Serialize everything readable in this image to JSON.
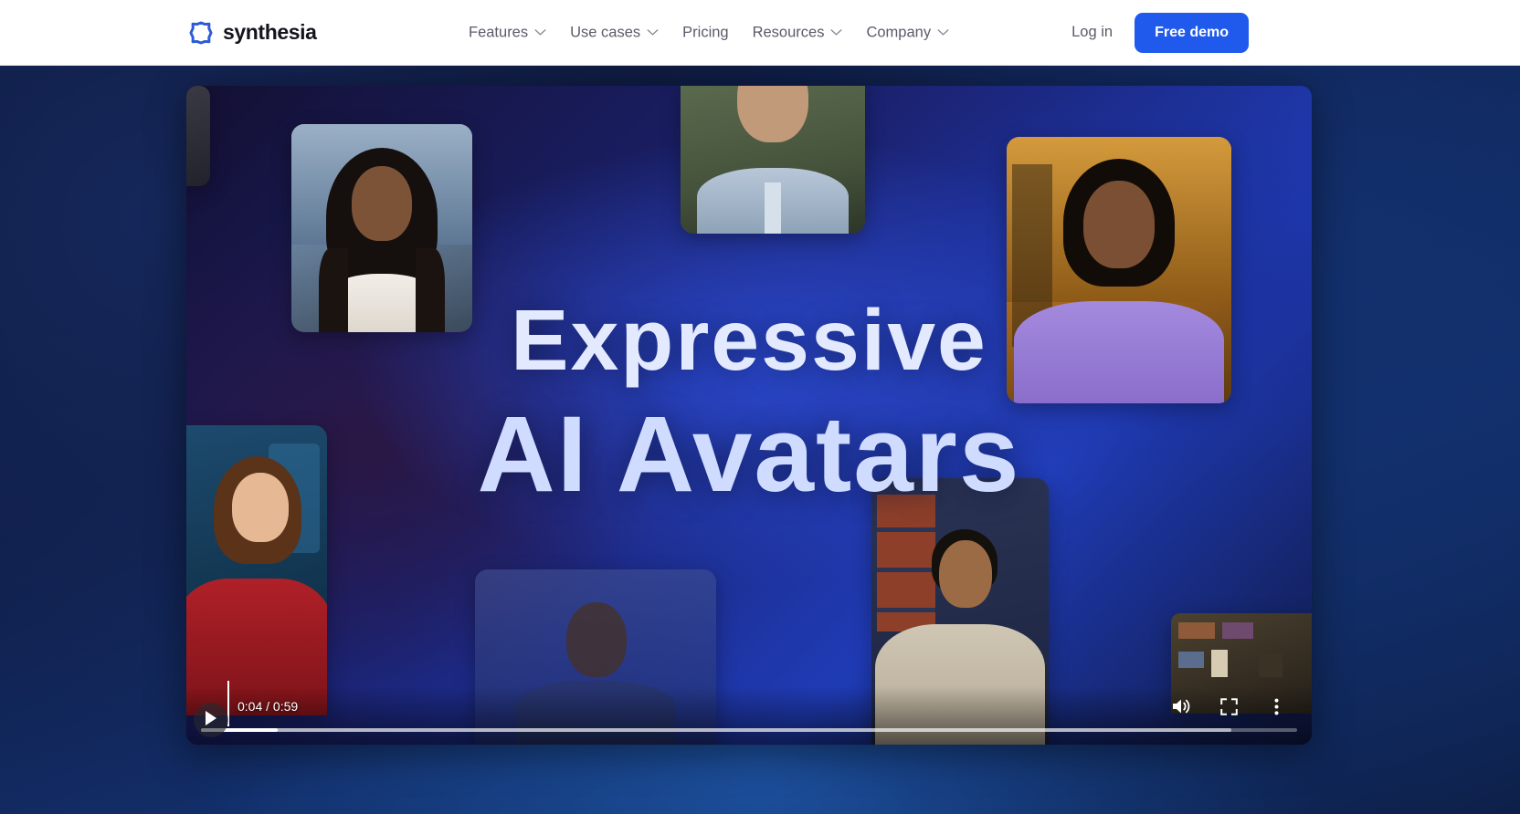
{
  "brand": {
    "name": "synthesia",
    "logo_icon": "synthesia-octagon-logo",
    "accent": "#1f5aec"
  },
  "nav": {
    "items": [
      {
        "label": "Features",
        "has_dropdown": true
      },
      {
        "label": "Use cases",
        "has_dropdown": true
      },
      {
        "label": "Pricing",
        "has_dropdown": false
      },
      {
        "label": "Resources",
        "has_dropdown": true
      },
      {
        "label": "Company",
        "has_dropdown": true
      }
    ],
    "login_label": "Log in",
    "demo_label": "Free demo"
  },
  "video": {
    "title_line1": "Expressive",
    "title_line2": "AI Avatars",
    "current_time": "0:04",
    "duration": "0:59",
    "time_display": "0:04 / 0:59",
    "progress_percent": 7,
    "buffered_percent": 94,
    "state": "paused",
    "controls": {
      "play_icon": "play-icon",
      "volume_icon": "volume-high-icon",
      "fullscreen_icon": "fullscreen-icon",
      "more_icon": "kebab-menu-icon"
    }
  }
}
